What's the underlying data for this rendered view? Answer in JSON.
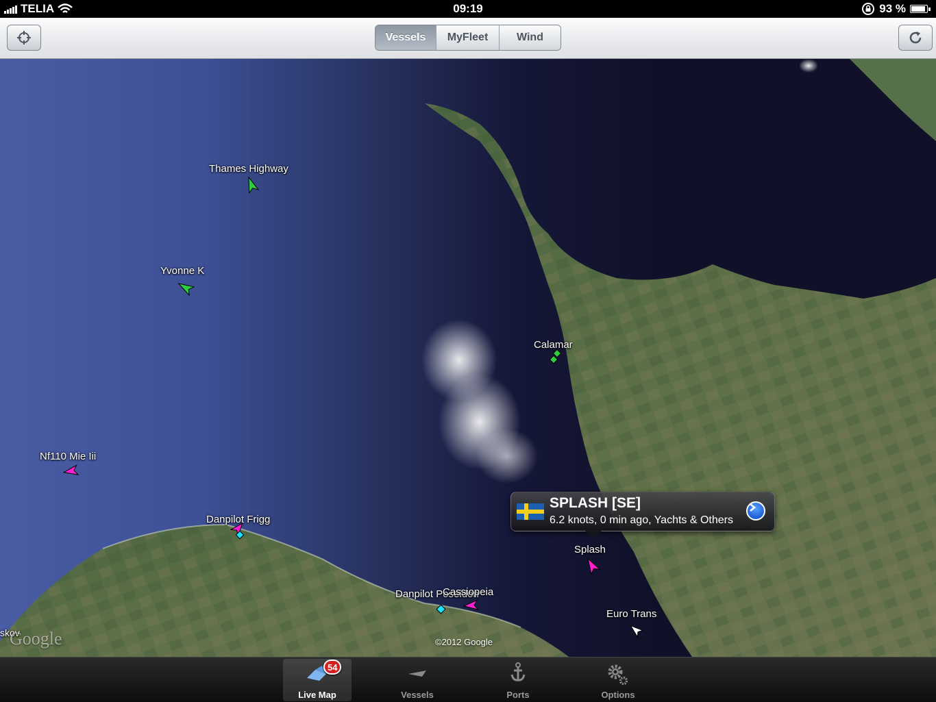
{
  "status_bar": {
    "carrier": "TELIA",
    "time": "09:19",
    "battery": "93 %",
    "battery_level": 0.93
  },
  "toolbar": {
    "locate_icon": "crosshair-icon",
    "refresh_icon": "refresh-icon",
    "segments": [
      {
        "label": "Vessels",
        "active": true
      },
      {
        "label": "MyFleet",
        "active": false
      },
      {
        "label": "Wind",
        "active": false
      }
    ]
  },
  "map": {
    "vessels": [
      {
        "name": "Thames Highway",
        "color": "#2ecc40"
      },
      {
        "name": "Yvonne K",
        "color": "#2ecc40"
      },
      {
        "name": "Calamar",
        "color": "#2ecc40"
      },
      {
        "name": "Nf110 Mie Iii",
        "color": "#ff1fd1"
      },
      {
        "name": "Danpilot Frigg",
        "color": "#ff1fd1"
      },
      {
        "name": "Splash",
        "color": "#ff1fd1"
      },
      {
        "name": "Danpilot Poseidon",
        "color": "#19e3ff"
      },
      {
        "name": "Cassiopeia",
        "color": "#ff1fd1"
      },
      {
        "name": "Euro Trans",
        "color": "#ffffff"
      }
    ],
    "place_fragment": "skov",
    "google_logo": "Google",
    "copyright": "©2012 Google",
    "callout": {
      "title": "SPLASH [SE]",
      "subtitle": "6.2 knots, 0 min ago, Yachts & Others",
      "flag": "sweden-flag"
    }
  },
  "tab_bar": {
    "tabs": [
      {
        "label": "Live Map",
        "icon": "live-map-icon",
        "active": true,
        "badge": "54"
      },
      {
        "label": "Vessels",
        "icon": "vessel-icon",
        "active": false
      },
      {
        "label": "Ports",
        "icon": "anchor-icon",
        "active": false
      },
      {
        "label": "Options",
        "icon": "gears-icon",
        "active": false
      }
    ]
  }
}
